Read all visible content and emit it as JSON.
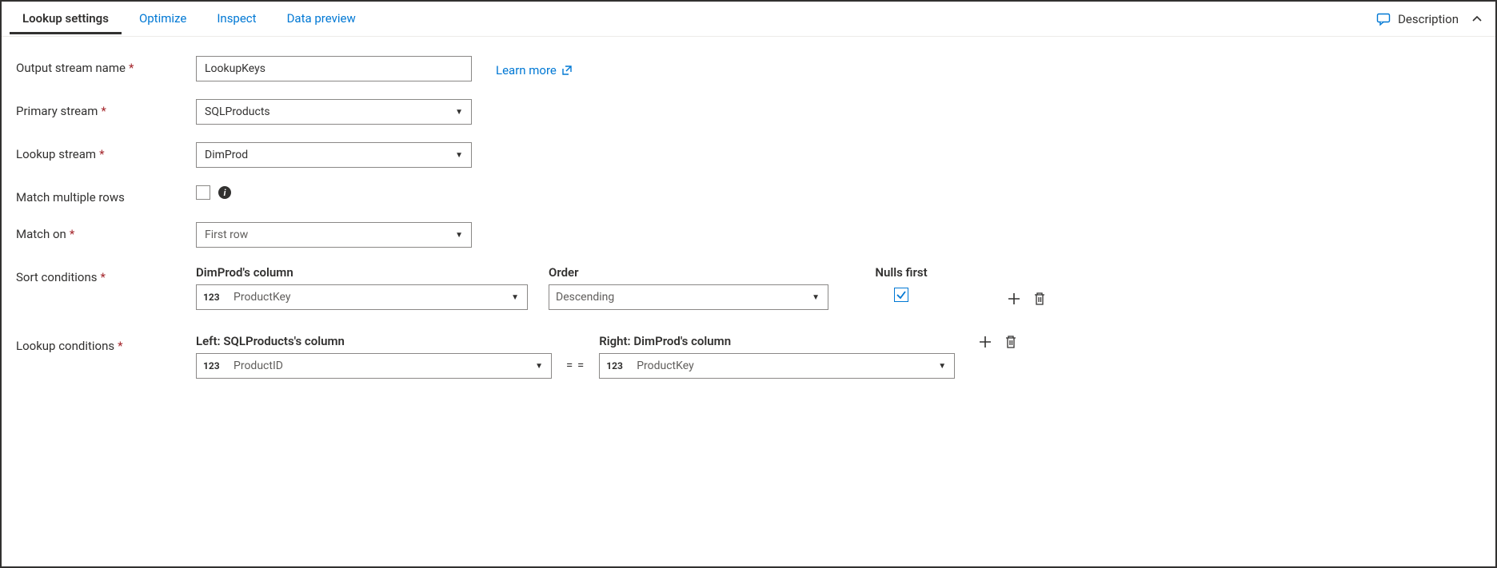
{
  "tabs": {
    "lookup": "Lookup settings",
    "optimize": "Optimize",
    "inspect": "Inspect",
    "preview": "Data preview"
  },
  "description_label": "Description",
  "fields": {
    "output_stream_label": "Output stream name",
    "output_stream_value": "LookupKeys",
    "learn_more": "Learn more",
    "primary_stream_label": "Primary stream",
    "primary_stream_value": "SQLProducts",
    "lookup_stream_label": "Lookup stream",
    "lookup_stream_value": "DimProd",
    "match_multiple_label": "Match multiple rows",
    "match_on_label": "Match on",
    "match_on_value": "First row",
    "sort_conditions_label": "Sort conditions",
    "lookup_conditions_label": "Lookup conditions"
  },
  "sort": {
    "col_header": "DimProd's column",
    "order_header": "Order",
    "nulls_header": "Nulls first",
    "type_tag": "123",
    "column_value": "ProductKey",
    "order_value": "Descending"
  },
  "lookup": {
    "left_header": "Left: SQLProducts's column",
    "right_header": "Right: DimProd's column",
    "type_tag": "123",
    "left_value": "ProductID",
    "right_value": "ProductKey",
    "eq": "= ="
  }
}
